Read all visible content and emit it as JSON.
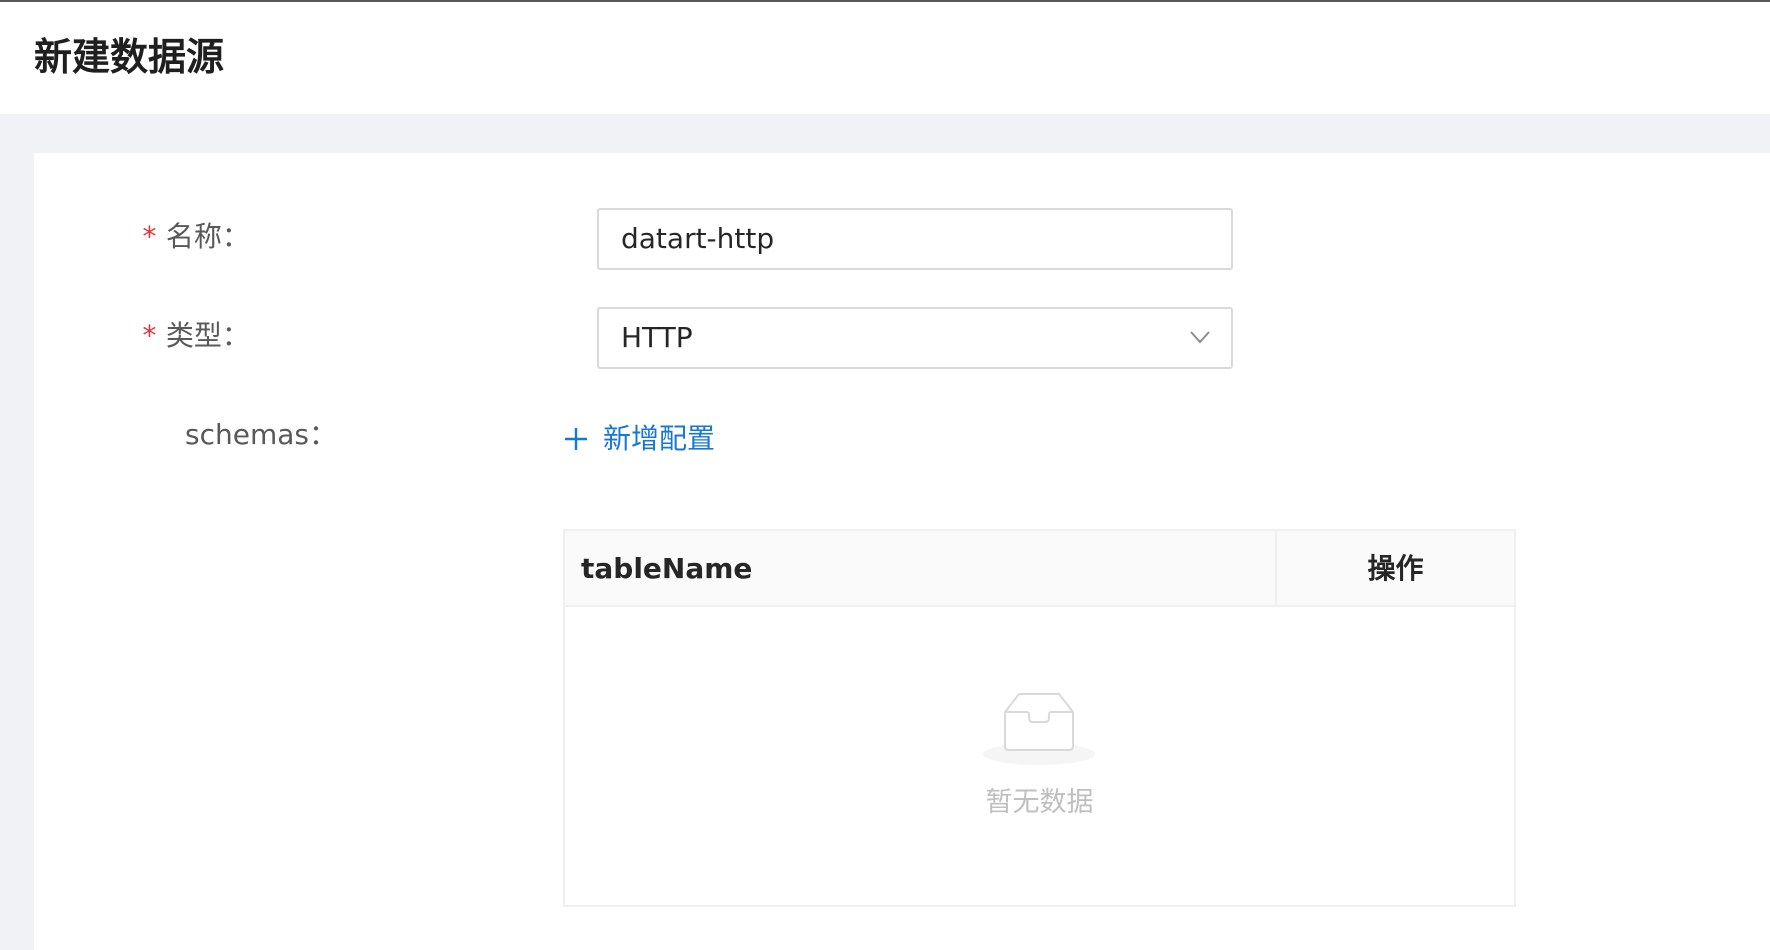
{
  "page": {
    "title": "新建数据源"
  },
  "form": {
    "name": {
      "required_mark": "*",
      "label": "名称：",
      "value": "datart-http"
    },
    "type": {
      "required_mark": "*",
      "label": "类型：",
      "value": "HTTP",
      "icon": "chevron-down-icon"
    },
    "schemas": {
      "label": "schemas：",
      "add_button": "新增配置",
      "add_icon": "plus-icon",
      "table": {
        "columns": [
          "tableName",
          "操作"
        ],
        "rows": [],
        "empty_text": "暂无数据",
        "empty_icon": "empty-inbox-icon"
      }
    }
  },
  "colors": {
    "required": "#d9363e",
    "link": "#1677d6",
    "background": "#f0f2f5"
  }
}
